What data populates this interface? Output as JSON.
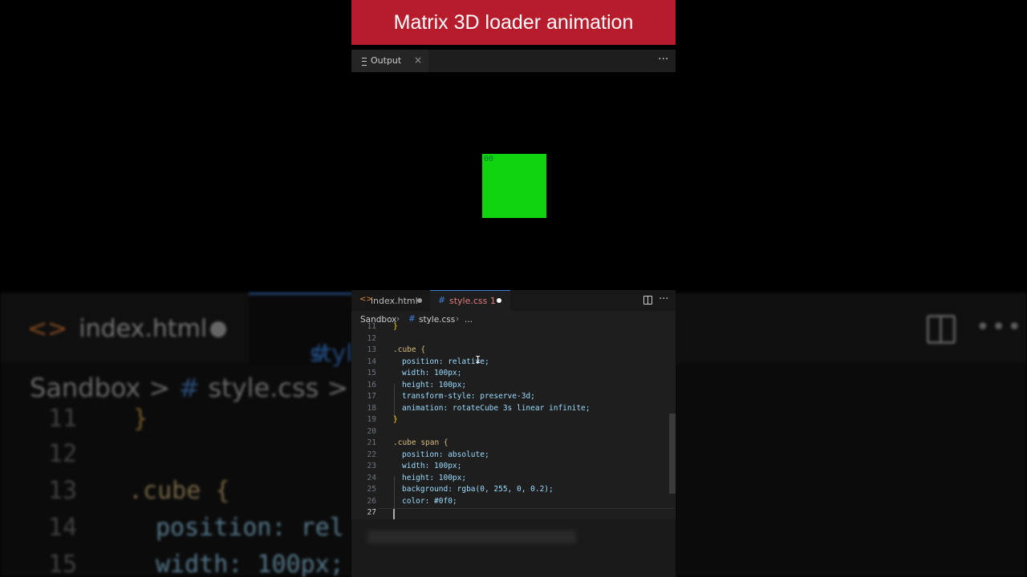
{
  "title": "Matrix 3D loader animation",
  "output_panel": {
    "tab_label": "Output",
    "close_glyph": "×",
    "more_glyph": "···",
    "icon": "output-list-icon"
  },
  "preview": {
    "cube_text": "00",
    "cube_color": "#10d410"
  },
  "editor": {
    "tabs": [
      {
        "label": "index.html",
        "icon": "html-file-icon",
        "modified": true
      },
      {
        "label": "style.css 1",
        "icon": "css-hash-icon",
        "modified": true,
        "active": true
      }
    ],
    "breadcrumb": {
      "root": "Sandbox",
      "sep": "›",
      "file": "style.css",
      "ellipsis": "..."
    },
    "lines": [
      {
        "n": "11",
        "code": "}"
      },
      {
        "n": "12",
        "code": ""
      },
      {
        "n": "13",
        "code": ".cube {"
      },
      {
        "n": "14",
        "code": "position: relative;"
      },
      {
        "n": "15",
        "code": "width: 100px;"
      },
      {
        "n": "16",
        "code": "height: 100px;"
      },
      {
        "n": "17",
        "code": "transform-style: preserve-3d;"
      },
      {
        "n": "18",
        "code": "animation: rotateCube 3s linear infinite;"
      },
      {
        "n": "19",
        "code": "}"
      },
      {
        "n": "20",
        "code": ""
      },
      {
        "n": "21",
        "code": ".cube span {"
      },
      {
        "n": "22",
        "code": "position: absolute;"
      },
      {
        "n": "23",
        "code": "width: 100px;"
      },
      {
        "n": "24",
        "code": "height: 100px;"
      },
      {
        "n": "25",
        "code": "background: rgba(0, 255, 0, 0.2);"
      },
      {
        "n": "26",
        "code": "color: #0f0;"
      },
      {
        "n": "27",
        "code": ""
      }
    ]
  },
  "background_zoom": {
    "tab_html": "index.html",
    "tab_css": "style.css",
    "crumb_root": "Sandbox",
    "crumb_sep": ">",
    "crumb_hash": "#",
    "crumb_file": "style.css",
    "crumb_sep2": ">",
    "lines": [
      {
        "n": "11",
        "code": "}"
      },
      {
        "n": "12",
        "code": ""
      },
      {
        "n": "13",
        "code": ".cube {"
      },
      {
        "n": "14",
        "code": "position: rel"
      },
      {
        "n": "15",
        "code": "width: 100px;"
      }
    ]
  }
}
